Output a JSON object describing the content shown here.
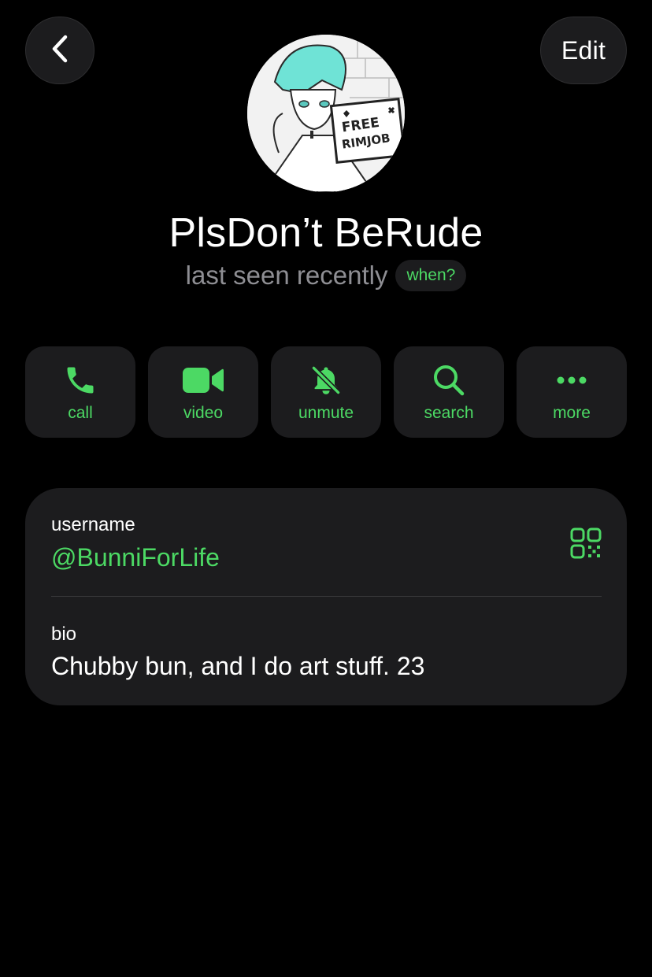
{
  "header": {
    "back_icon": "chevron-left-icon",
    "edit_label": "Edit"
  },
  "profile": {
    "avatar": "avatar-image",
    "avatar_sign_text": "FREE RIMJOB",
    "name": "PlsDon’t BeRude",
    "status": "last seen recently",
    "status_badge": "when?"
  },
  "actions": [
    {
      "label": "call",
      "icon": "phone-icon"
    },
    {
      "label": "video",
      "icon": "video-camera-icon"
    },
    {
      "label": "unmute",
      "icon": "bell-slash-icon"
    },
    {
      "label": "search",
      "icon": "search-icon"
    },
    {
      "label": "more",
      "icon": "more-dots-icon"
    }
  ],
  "info": {
    "username_label": "username",
    "username_value": "@BunniForLife",
    "qr_icon": "qr-code-icon",
    "bio_label": "bio",
    "bio_value": "Chubby bun, and I do art stuff. 23"
  },
  "colors": {
    "accent": "#4cd964",
    "background": "#000000",
    "card": "#1c1c1e",
    "secondary_text": "#8e8e93"
  }
}
